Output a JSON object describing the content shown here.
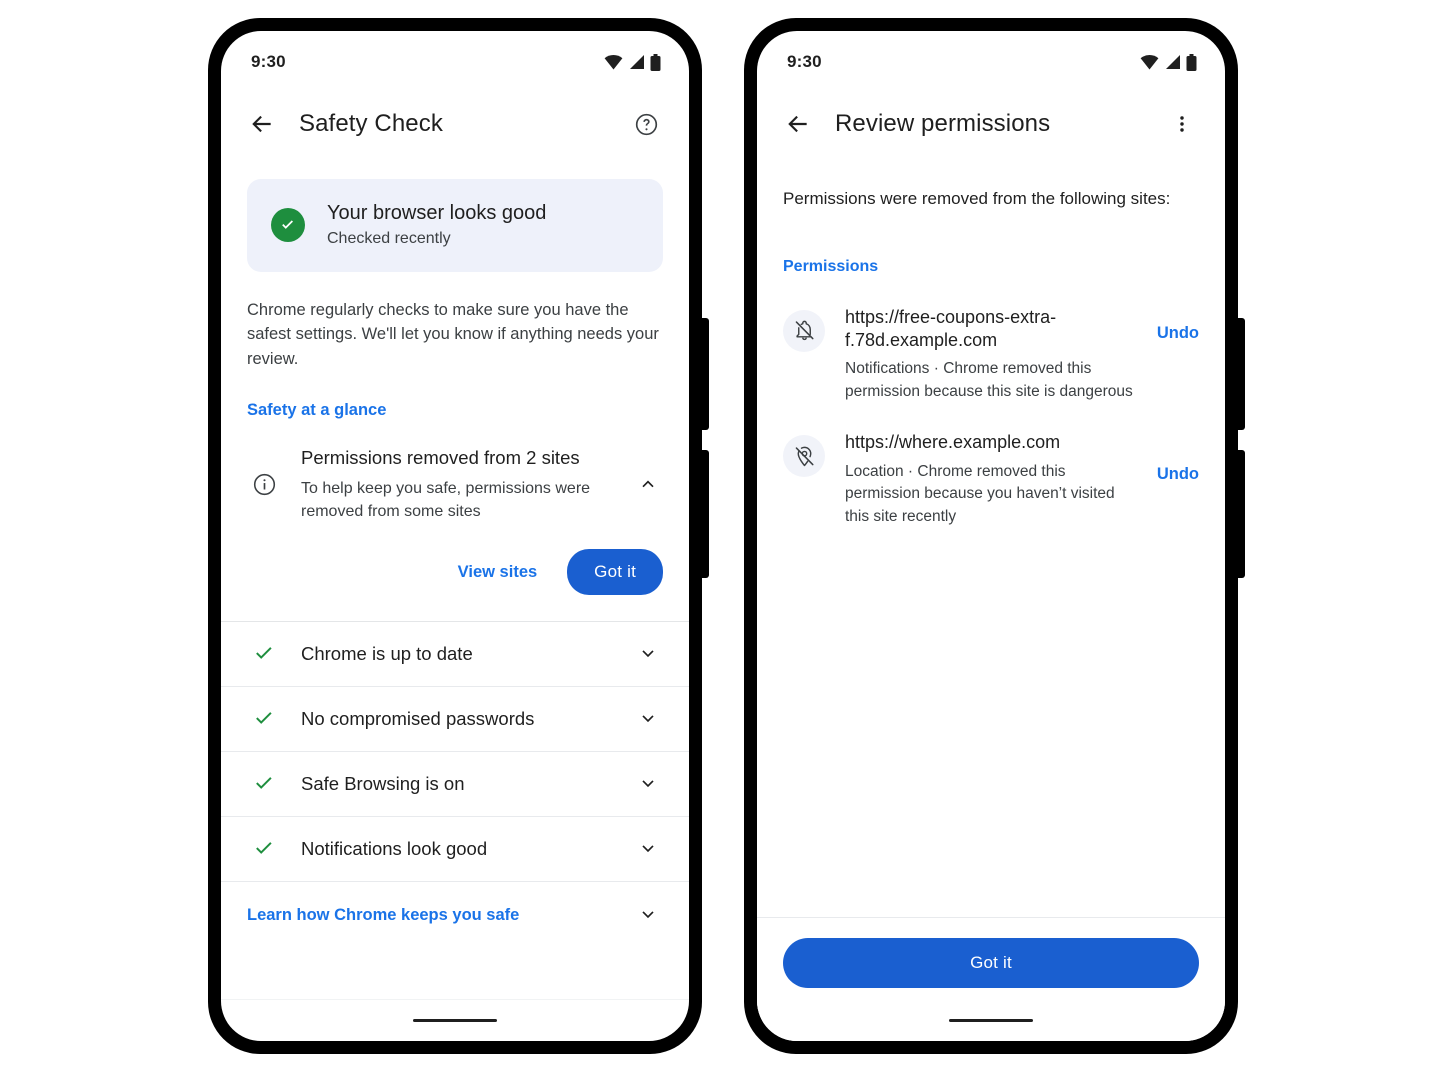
{
  "colors": {
    "accent_blue": "#1a73e8",
    "button_blue": "#1a5fd0",
    "success_green": "#1e8e3e",
    "banner_bg": "#eef1fa",
    "text_primary": "#1f1f1f",
    "text_secondary": "#3c4043"
  },
  "phone_left": {
    "status_bar": {
      "time": "9:30",
      "icons": [
        "wifi-icon",
        "cellular-signal-icon",
        "battery-icon"
      ]
    },
    "app_bar": {
      "back_icon": "back-arrow-icon",
      "title": "Safety Check",
      "action_icon": "help-circle-icon"
    },
    "status_card": {
      "icon": "check-circle-icon",
      "title": "Your browser looks good",
      "subtitle": "Checked recently"
    },
    "description": "Chrome regularly checks to make sure you have the safest settings. We'll let you know if anything needs your review.",
    "section_link": "Safety at a glance",
    "expanded_item": {
      "icon": "info-circle-icon",
      "title": "Permissions removed from 2 sites",
      "subtitle": "To help keep you safe, permissions were removed from some sites",
      "chevron": "chevron-up-icon",
      "secondary_action": "View sites",
      "primary_action": "Got it"
    },
    "check_rows": [
      {
        "icon": "check-icon",
        "label": "Chrome is up to date",
        "chevron": "chevron-down-icon"
      },
      {
        "icon": "check-icon",
        "label": "No compromised passwords",
        "chevron": "chevron-down-icon"
      },
      {
        "icon": "check-icon",
        "label": "Safe Browsing is on",
        "chevron": "chevron-down-icon"
      },
      {
        "icon": "check-icon",
        "label": "Notifications look good",
        "chevron": "chevron-down-icon"
      }
    ],
    "learn_row": {
      "label": "Learn how Chrome keeps you safe",
      "chevron": "chevron-down-icon"
    }
  },
  "phone_right": {
    "status_bar": {
      "time": "9:30",
      "icons": [
        "wifi-icon",
        "cellular-signal-icon",
        "battery-icon"
      ]
    },
    "app_bar": {
      "back_icon": "back-arrow-icon",
      "title": "Review permissions",
      "action_icon": "overflow-menu-icon"
    },
    "intro": "Permissions were removed from the following sites:",
    "section_label": "Permissions",
    "permissions": [
      {
        "icon": "notifications-off-icon",
        "url": "https://free-coupons-extra-f.78d.example.com",
        "detail": "Notifications · Chrome removed this permission because this site is dangerous",
        "action": "Undo"
      },
      {
        "icon": "location-off-icon",
        "url": "https://where.example.com",
        "detail": "Location · Chrome removed this permission because you haven’t visited this site recently",
        "action": "Undo"
      }
    ],
    "bottom_action": "Got it"
  }
}
